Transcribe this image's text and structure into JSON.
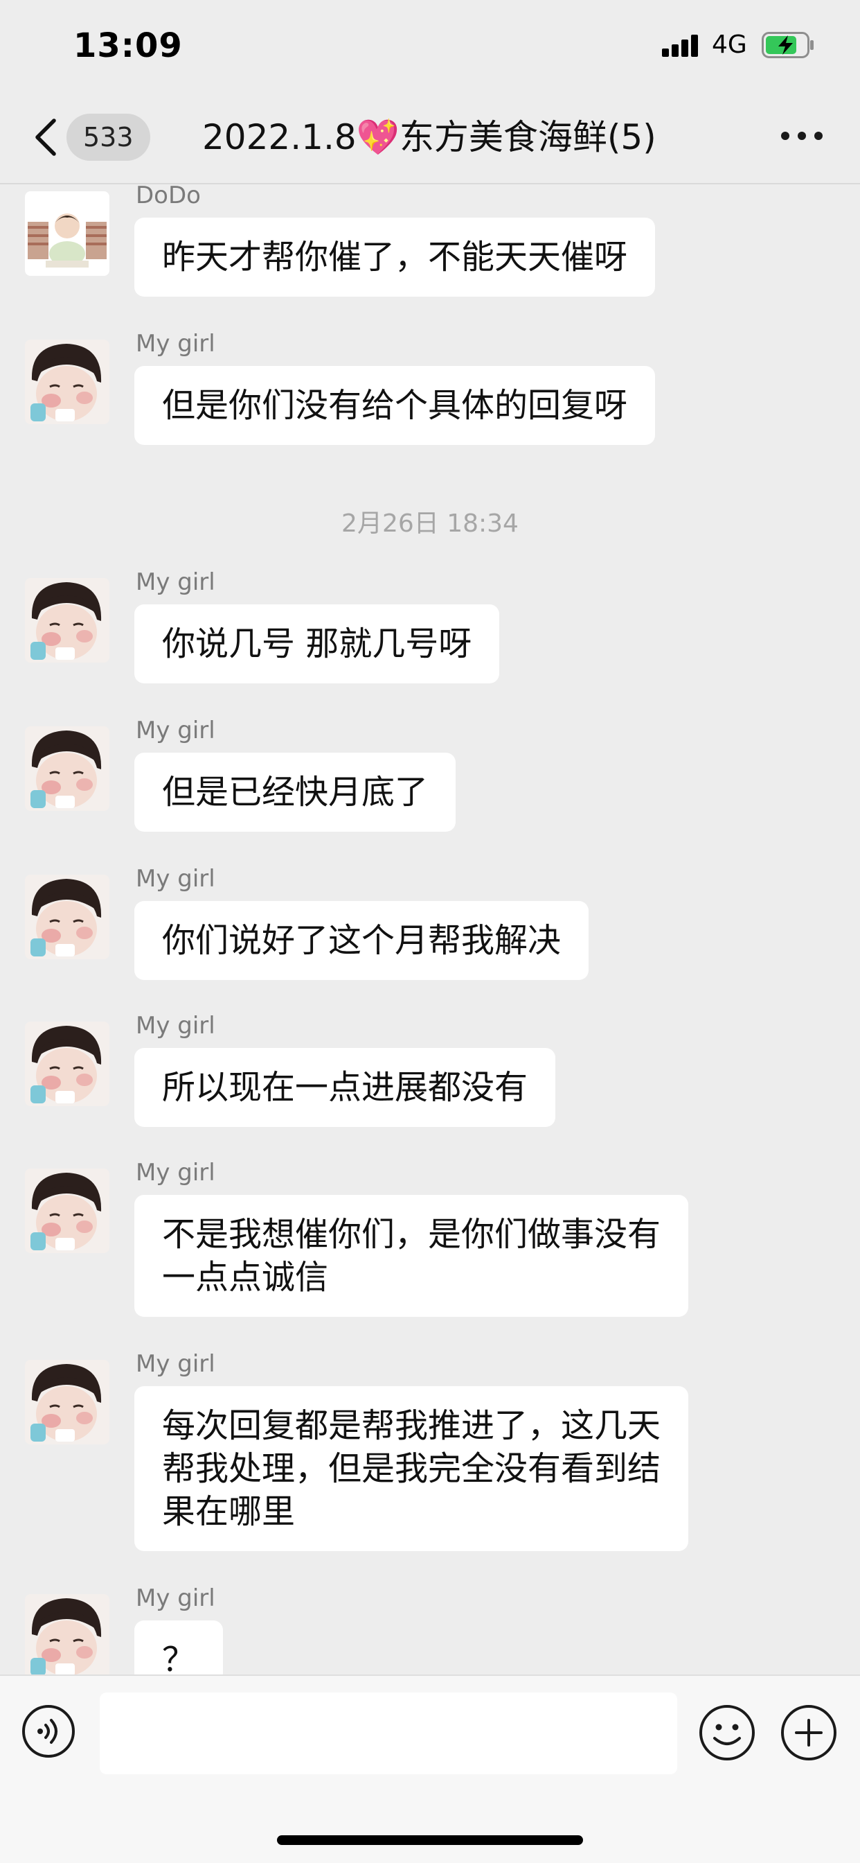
{
  "status_bar": {
    "time": "13:09",
    "network": "4G"
  },
  "nav": {
    "unread_count": "533",
    "title": "2022.1.8💖东方美食海鲜(5)"
  },
  "messages": [
    {
      "sender": "DoDo",
      "text": "昨天才帮你催了，不能天天催呀",
      "avatar": "dodo"
    },
    {
      "sender": "My girl",
      "text": "但是你们没有给个具体的回复呀",
      "avatar": "girl"
    },
    {
      "timestamp": "2月26日 18:34"
    },
    {
      "sender": "My girl",
      "text": "你说几号 那就几号呀",
      "avatar": "girl"
    },
    {
      "sender": "My girl",
      "text": "但是已经快月底了",
      "avatar": "girl"
    },
    {
      "sender": "My girl",
      "text": "你们说好了这个月帮我解决",
      "avatar": "girl"
    },
    {
      "sender": "My girl",
      "text": "所以现在一点进展都没有",
      "avatar": "girl"
    },
    {
      "sender": "My girl",
      "text": "不是我想催你们，是你们做事没有\n一点点诚信",
      "avatar": "girl"
    },
    {
      "sender": "My girl",
      "text": "每次回复都是帮我推进了，这几天\n帮我处理，但是我完全没有看到结\n果在哪里",
      "avatar": "girl"
    },
    {
      "sender": "My girl",
      "text": "？",
      "avatar": "girl"
    }
  ],
  "input": {
    "value": "",
    "placeholder": ""
  },
  "colors": {
    "background": "#ededed",
    "bubble": "#ffffff",
    "battery_fill": "#34c759"
  },
  "icons": {
    "back": "chevron-left-icon",
    "more": "more-dots-icon",
    "voice": "voice-icon",
    "emoji": "emoji-icon",
    "plus": "plus-icon"
  }
}
